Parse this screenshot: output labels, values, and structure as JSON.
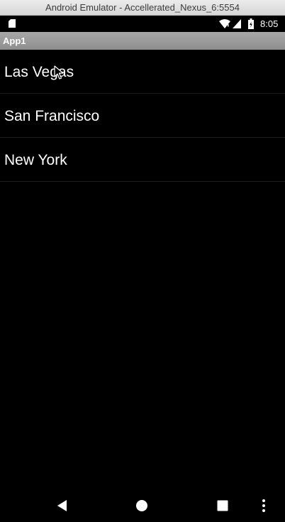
{
  "window": {
    "title": "Android Emulator - Accellerated_Nexus_6:5554"
  },
  "status_bar": {
    "time": "8:05",
    "icons": [
      "sd-card-icon",
      "wifi-icon",
      "signal-icon",
      "battery-charging-icon"
    ]
  },
  "app_bar": {
    "title": "App1"
  },
  "list": {
    "items": [
      {
        "label": "Las Vegas"
      },
      {
        "label": "San Francisco"
      },
      {
        "label": "New York"
      }
    ]
  },
  "nav_bar": {
    "icons": [
      "back-icon",
      "home-icon",
      "recents-icon",
      "overflow-menu-icon"
    ]
  },
  "colors": {
    "background": "#000000",
    "app_bar": "#9a9a9a",
    "text": "#ffffff",
    "divider": "#1c1c1c"
  }
}
